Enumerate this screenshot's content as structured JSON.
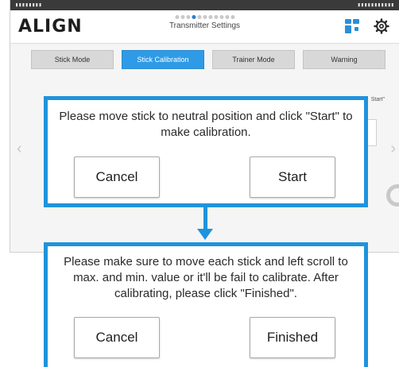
{
  "status_bar": {
    "left": "▮▮▮▮▮▮▮▮",
    "right": "▮▮▮▮▮▮▮▮▮▮▮"
  },
  "app_header": {
    "logo": "ALIGN",
    "title": "Transmitter Settings",
    "page_count": 11,
    "active_page": 3
  },
  "tabs": [
    {
      "label": "Stick Mode",
      "active": false
    },
    {
      "label": "Stick Calibration",
      "active": true
    },
    {
      "label": "Trainer Mode",
      "active": false
    },
    {
      "label": "Warning",
      "active": false
    }
  ],
  "background": {
    "start_hint": "Start\""
  },
  "dialogs": [
    {
      "message": "Please move stick to neutral position and click \"Start\" to make calibration.",
      "cancel_label": "Cancel",
      "confirm_label": "Start"
    },
    {
      "message": "Please make sure to move each stick and left scroll to max. and min. value or it'll be fail to calibrate. After calibrating, please click \"Finished\".",
      "cancel_label": "Cancel",
      "confirm_label": "Finished"
    }
  ],
  "colors": {
    "accent": "#1f93dc",
    "active_tab": "#2f9be6",
    "tab": "#d8d8d8"
  },
  "icons": {
    "apps": "grid-icon",
    "settings": "gear-icon"
  }
}
